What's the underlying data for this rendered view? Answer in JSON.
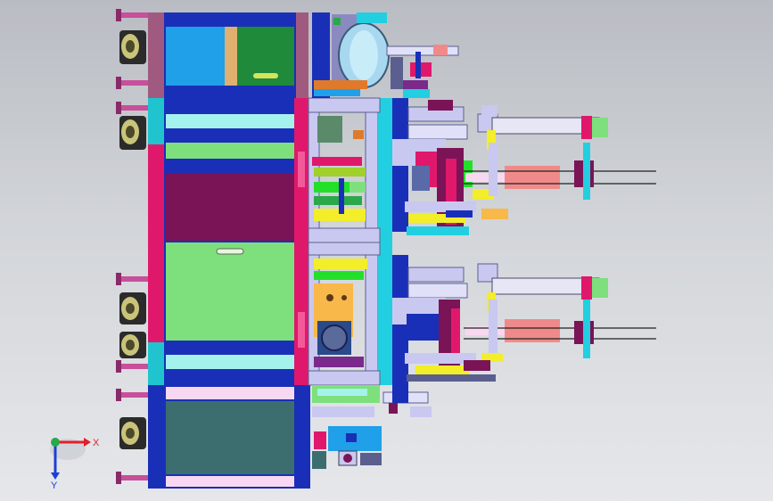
{
  "viewport": {
    "background_top": "#b9bcc2",
    "background_bottom": "#e6e7ea"
  },
  "triad": {
    "x_label": "X",
    "y_label": "Y",
    "x_color": "#e0202a",
    "y_color": "#1c3fd6",
    "origin_color": "#2aa84a"
  },
  "palette": {
    "navy": "#1a2fb8",
    "magenta": "#e0186c",
    "light_green": "#7ee07c",
    "cyan": "#22cfe0",
    "purple": "#7a1457",
    "teal_dark": "#3c6e70",
    "lavender": "#c9c8f0",
    "pink": "#f08a8a",
    "yellow": "#f2ee2a",
    "slate": "#5a5f8f"
  }
}
